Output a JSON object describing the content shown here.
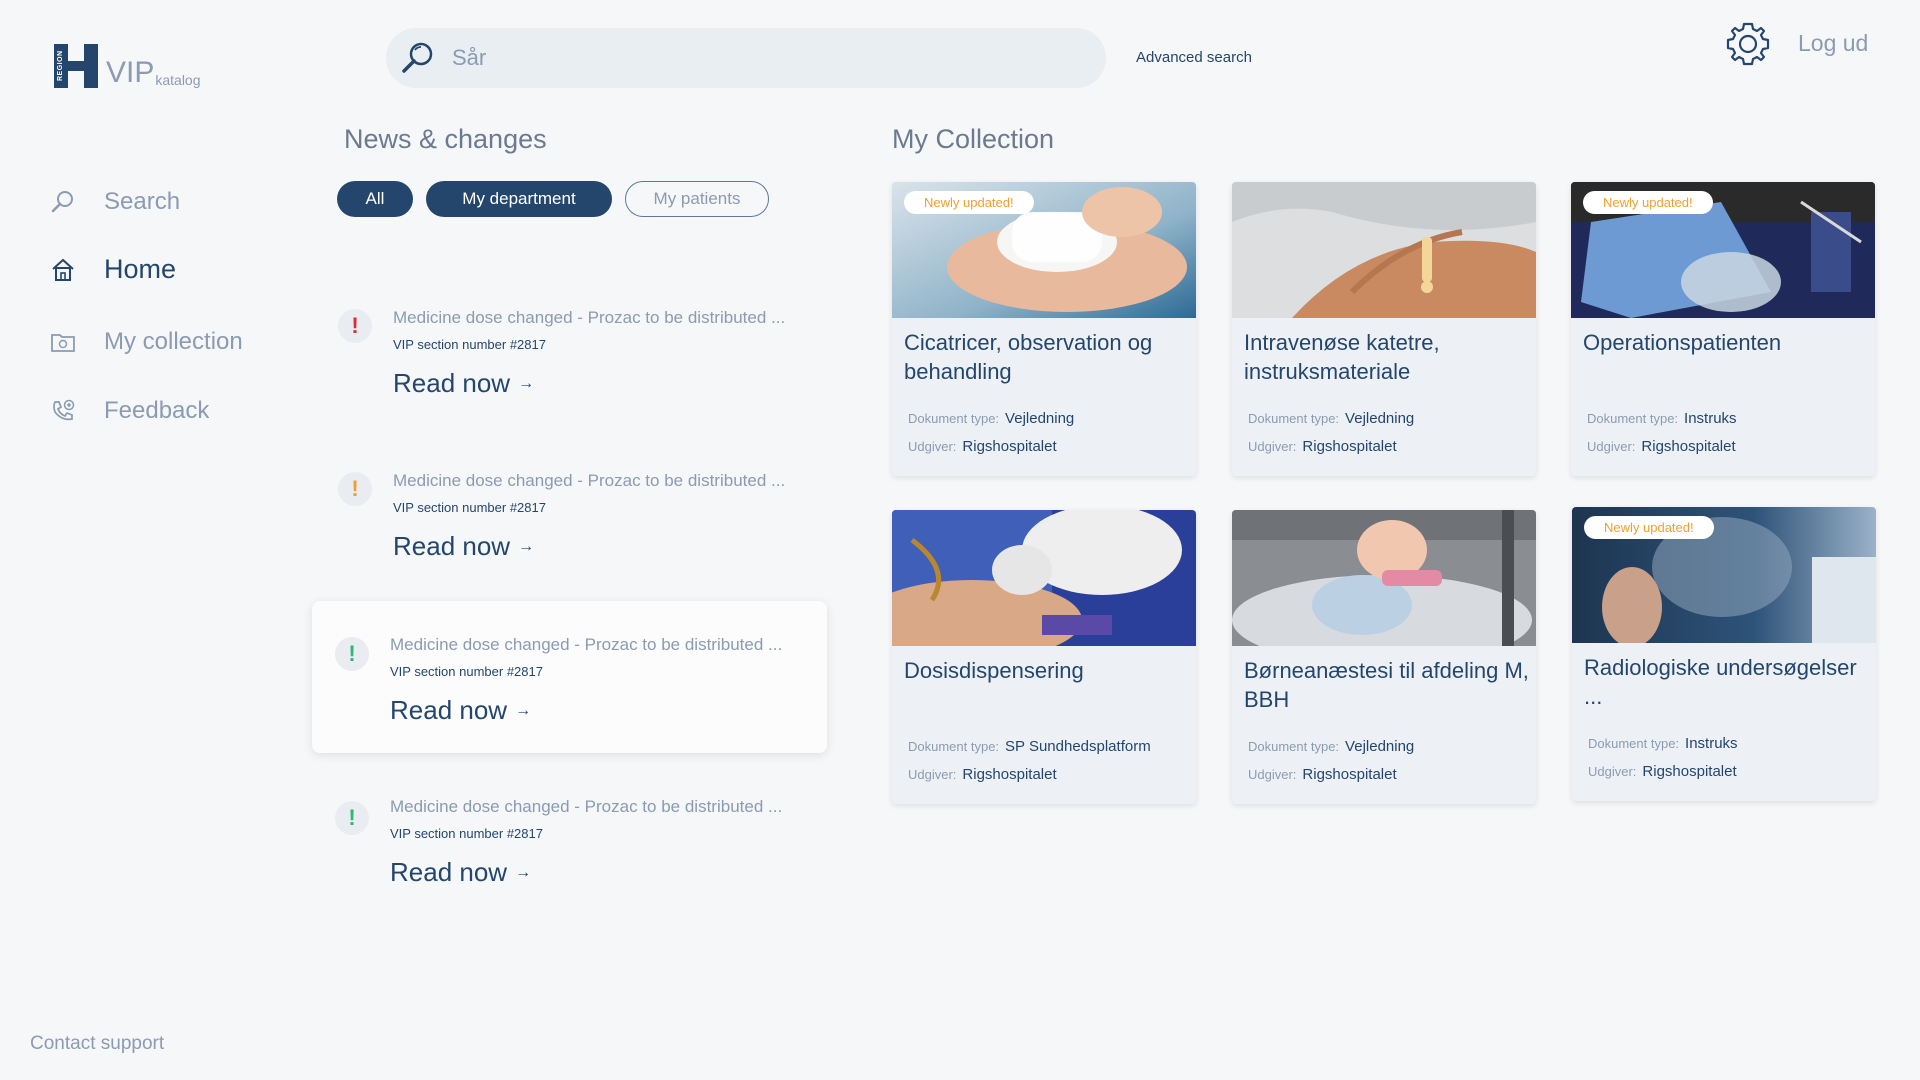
{
  "logo": {
    "region": "REGION",
    "letter": "H",
    "vip": "VIP",
    "katalog": "katalog"
  },
  "sidebar": {
    "items": [
      {
        "label": "Search",
        "icon": "search-icon"
      },
      {
        "label": "Home",
        "icon": "home-icon"
      },
      {
        "label": "My collection",
        "icon": "folder-icon"
      },
      {
        "label": "Feedback",
        "icon": "phone-feedback-icon"
      }
    ],
    "active": "Home",
    "contact": "Contact support"
  },
  "topbar": {
    "search_value": "Sår",
    "advanced_search": "Advanced search",
    "logout": "Log ud"
  },
  "news": {
    "title": "News & changes",
    "filters": [
      "All",
      "My department",
      "My patients"
    ],
    "items": [
      {
        "title": "Medicine dose changed - Prozac to be distributed ...",
        "sub": "VIP section number #2817",
        "link": "Read now",
        "severity": "high",
        "color": "#e0283a"
      },
      {
        "title": "Medicine dose changed - Prozac to be distributed ...",
        "sub": "VIP section number #2817",
        "link": "Read now",
        "severity": "medium",
        "color": "#f0a030"
      },
      {
        "title": "Medicine dose changed - Prozac to be distributed ...",
        "sub": "VIP section number #2817",
        "link": "Read now",
        "severity": "low",
        "color": "#2eb872"
      },
      {
        "title": "Medicine dose changed - Prozac to be distributed ...",
        "sub": "VIP section number #2817",
        "link": "Read now",
        "severity": "low",
        "color": "#2eb872"
      }
    ]
  },
  "collection": {
    "title": "My Collection",
    "type_label": "Dokument type:",
    "publisher_label": "Udgiver:",
    "new_tag": "Newly updated!",
    "cards": [
      {
        "title": "Cicatricer, observation og behandling",
        "type": "Vejledning",
        "publisher": "Rigshospitalet",
        "new": true
      },
      {
        "title": "Intravenøse katetre, instruksmateriale",
        "type": "Vejledning",
        "publisher": "Rigshospitalet",
        "new": false
      },
      {
        "title": "Operationspatienten",
        "type": "Instruks",
        "publisher": "Rigshospitalet",
        "new": true
      },
      {
        "title": "Dosisdispensering",
        "type": "SP Sundhedsplatform",
        "publisher": "Rigshospitalet",
        "new": false
      },
      {
        "title": "Børneanæstesi til afdeling M, BBH",
        "type": "Vejledning",
        "publisher": "Rigshospitalet",
        "new": false
      },
      {
        "title": "Radiologiske undersøgelser ...",
        "type": "Instruks",
        "publisher": "Rigshospitalet",
        "new": true
      }
    ]
  },
  "colors": {
    "primary": "#24466d",
    "muted": "#8b9bb1",
    "accent_new": "#f0a030"
  }
}
